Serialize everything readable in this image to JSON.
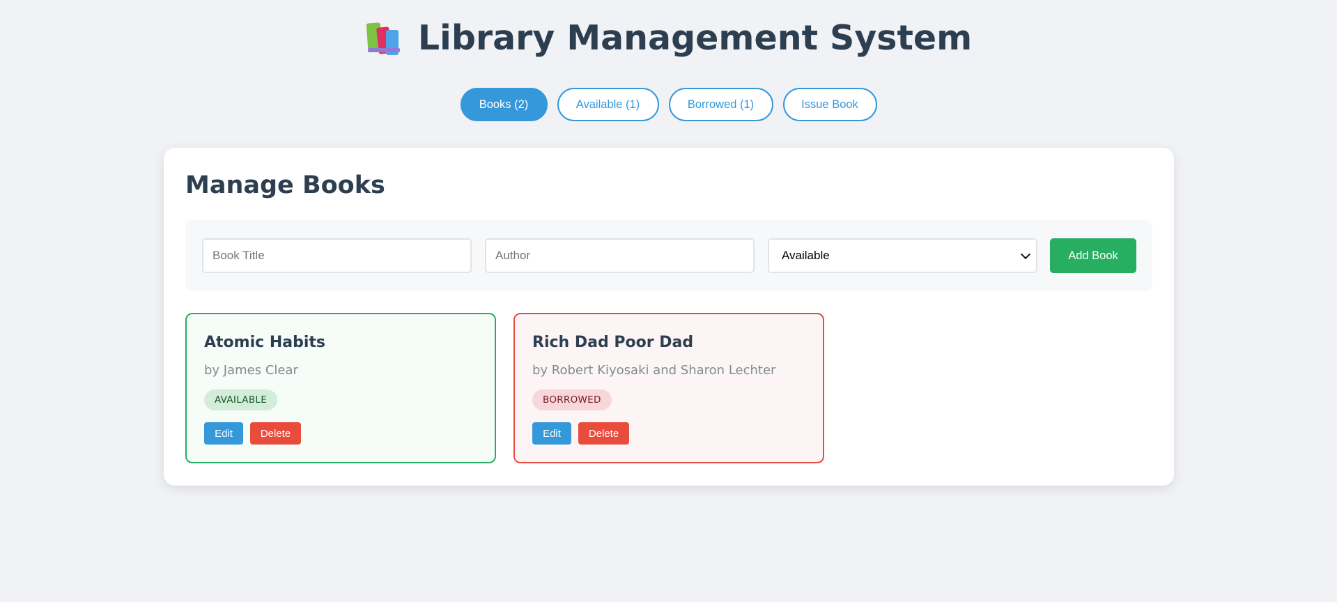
{
  "header": {
    "icon": "books-icon",
    "title": "Library Management System"
  },
  "tabs": [
    {
      "label": "Books (2)",
      "active": true
    },
    {
      "label": "Available (1)",
      "active": false
    },
    {
      "label": "Borrowed (1)",
      "active": false
    },
    {
      "label": "Issue Book",
      "active": false
    }
  ],
  "panel": {
    "title": "Manage Books",
    "form": {
      "title_placeholder": "Book Title",
      "title_value": "",
      "author_placeholder": "Author",
      "author_value": "",
      "status_selected": "Available",
      "add_label": "Add Book"
    },
    "books": [
      {
        "title": "Atomic Habits",
        "author": "by James Clear",
        "status": "AVAILABLE",
        "edit_label": "Edit",
        "delete_label": "Delete"
      },
      {
        "title": "Rich Dad Poor Dad",
        "author": "by Robert Kiyosaki and Sharon Lechter",
        "status": "BORROWED",
        "edit_label": "Edit",
        "delete_label": "Delete"
      }
    ]
  },
  "colors": {
    "primary": "#3498db",
    "success": "#27ae60",
    "danger": "#e74c3c",
    "text": "#2c3e50",
    "background": "#f0f2f5"
  }
}
